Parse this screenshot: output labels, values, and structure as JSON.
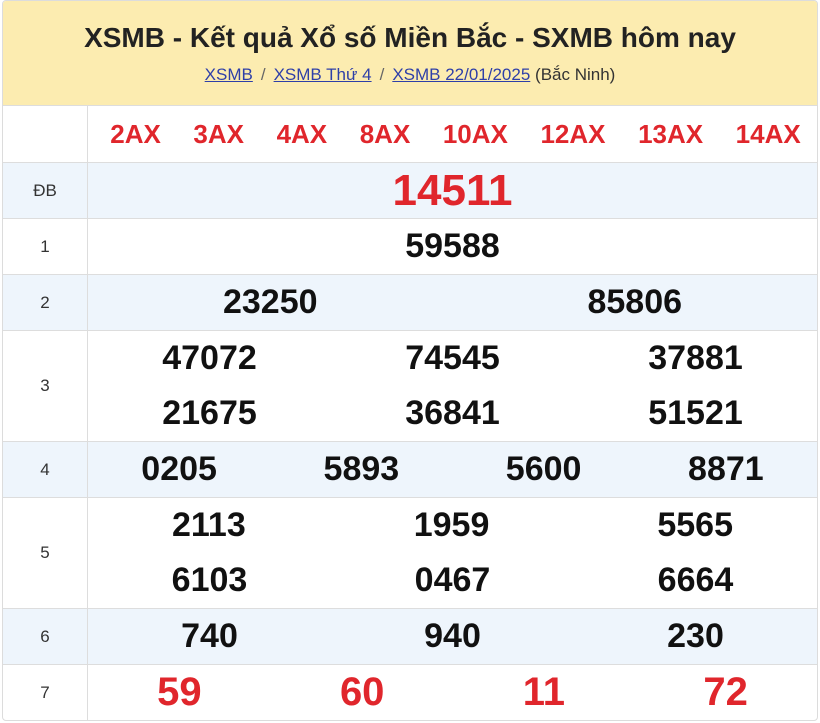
{
  "header": {
    "title": "XSMB - Kết quả Xổ số Miền Bắc - SXMB hôm nay",
    "breadcrumb": [
      {
        "label": "XSMB"
      },
      {
        "label": "XSMB Thứ 4"
      },
      {
        "label": "XSMB 22/01/2025"
      }
    ],
    "separator": "/",
    "province": "(Bắc Ninh)"
  },
  "codes": [
    "2AX",
    "3AX",
    "4AX",
    "8AX",
    "10AX",
    "12AX",
    "13AX",
    "14AX"
  ],
  "prizes": {
    "db": {
      "label": "ĐB",
      "nums": [
        "14511"
      ]
    },
    "p1": {
      "label": "1",
      "nums": [
        "59588"
      ]
    },
    "p2": {
      "label": "2",
      "nums": [
        "23250",
        "85806"
      ]
    },
    "p3": {
      "label": "3",
      "nums": [
        "47072",
        "74545",
        "37881",
        "21675",
        "36841",
        "51521"
      ]
    },
    "p4": {
      "label": "4",
      "nums": [
        "0205",
        "5893",
        "5600",
        "8871"
      ]
    },
    "p5": {
      "label": "5",
      "nums": [
        "2113",
        "1959",
        "5565",
        "6103",
        "0467",
        "6664"
      ]
    },
    "p6": {
      "label": "6",
      "nums": [
        "740",
        "940",
        "230"
      ]
    },
    "p7": {
      "label": "7",
      "nums": [
        "59",
        "60",
        "11",
        "72"
      ]
    }
  },
  "colors": {
    "header_bg": "#fcecb0",
    "accent_red": "#e0262c",
    "row_alt": "#eef5fc",
    "link": "#2e3fa8"
  }
}
